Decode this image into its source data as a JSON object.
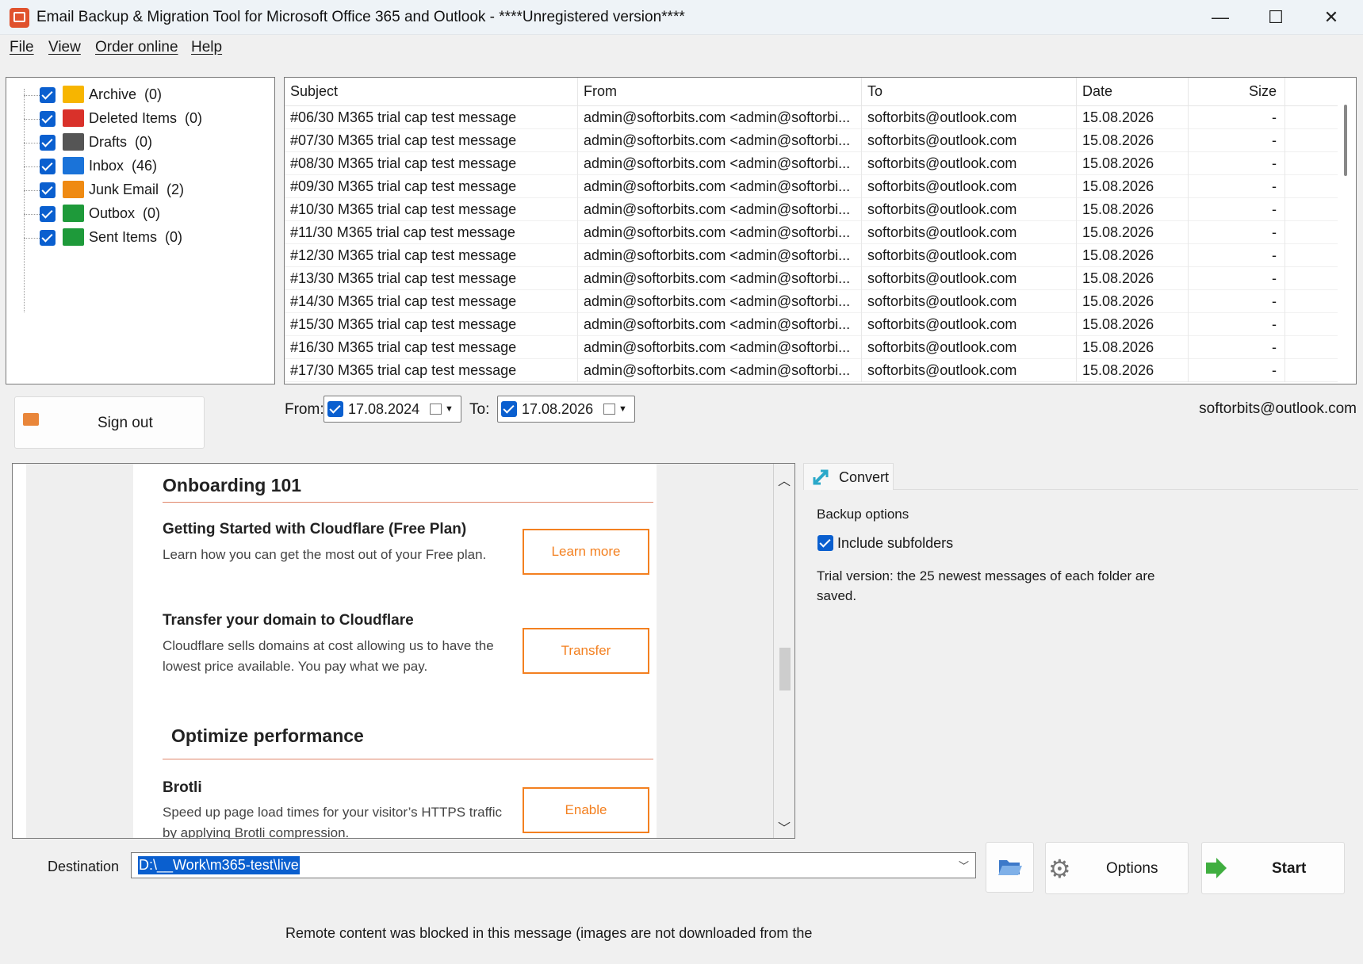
{
  "window": {
    "title": "Email Backup & Migration Tool for Microsoft Office 365 and Outlook - ****Unregistered version****",
    "controls": [
      "—",
      "☐",
      "✕"
    ]
  },
  "menu": [
    "File",
    "View",
    "Order online",
    "Help"
  ],
  "folders": [
    {
      "name": "Archive",
      "count": "(0)",
      "color": "#f7b500",
      "icon": "folder-icon"
    },
    {
      "name": "Deleted Items",
      "count": "(0)",
      "color": "#d9312a",
      "icon": "deleted-folder-icon"
    },
    {
      "name": "Drafts",
      "count": "(0)",
      "color": "#555555",
      "icon": "drafts-folder-icon"
    },
    {
      "name": "Inbox",
      "count": "(46)",
      "color": "#1a73d9",
      "icon": "inbox-folder-icon"
    },
    {
      "name": "Junk Email",
      "count": "(2)",
      "color": "#ef8a12",
      "icon": "junk-folder-icon"
    },
    {
      "name": "Outbox",
      "count": "(0)",
      "color": "#1e9a3a",
      "icon": "outbox-folder-icon"
    },
    {
      "name": "Sent Items",
      "count": "(0)",
      "color": "#1e9a3a",
      "icon": "sent-folder-icon"
    }
  ],
  "grid": {
    "columns": [
      "Subject",
      "From",
      "To",
      "Date",
      "Size"
    ],
    "rows": [
      [
        "#06/30 M365 trial cap test message",
        "admin@softorbits.com <admin@softorbi...",
        "softorbits@outlook.com",
        "15.08.2026",
        "-"
      ],
      [
        "#07/30 M365 trial cap test message",
        "admin@softorbits.com <admin@softorbi...",
        "softorbits@outlook.com",
        "15.08.2026",
        "-"
      ],
      [
        "#08/30 M365 trial cap test message",
        "admin@softorbits.com <admin@softorbi...",
        "softorbits@outlook.com",
        "15.08.2026",
        "-"
      ],
      [
        "#09/30 M365 trial cap test message",
        "admin@softorbits.com <admin@softorbi...",
        "softorbits@outlook.com",
        "15.08.2026",
        "-"
      ],
      [
        "#10/30 M365 trial cap test message",
        "admin@softorbits.com <admin@softorbi...",
        "softorbits@outlook.com",
        "15.08.2026",
        "-"
      ],
      [
        "#11/30 M365 trial cap test message",
        "admin@softorbits.com <admin@softorbi...",
        "softorbits@outlook.com",
        "15.08.2026",
        "-"
      ],
      [
        "#12/30 M365 trial cap test message",
        "admin@softorbits.com <admin@softorbi...",
        "softorbits@outlook.com",
        "15.08.2026",
        "-"
      ],
      [
        "#13/30 M365 trial cap test message",
        "admin@softorbits.com <admin@softorbi...",
        "softorbits@outlook.com",
        "15.08.2026",
        "-"
      ],
      [
        "#14/30 M365 trial cap test message",
        "admin@softorbits.com <admin@softorbi...",
        "softorbits@outlook.com",
        "15.08.2026",
        "-"
      ],
      [
        "#15/30 M365 trial cap test message",
        "admin@softorbits.com <admin@softorbi...",
        "softorbits@outlook.com",
        "15.08.2026",
        "-"
      ],
      [
        "#16/30 M365 trial cap test message",
        "admin@softorbits.com <admin@softorbi...",
        "softorbits@outlook.com",
        "15.08.2026",
        "-"
      ],
      [
        "#17/30 M365 trial cap test message",
        "admin@softorbits.com <admin@softorbi...",
        "softorbits@outlook.com",
        "15.08.2026",
        "-"
      ]
    ]
  },
  "signout_label": "Sign out",
  "date_range": {
    "from_label": "From:",
    "from_value": "17.08.2024",
    "to_label": "To:",
    "to_value": "17.08.2026"
  },
  "account": "softorbits@outlook.com",
  "preview": {
    "heading1": "Onboarding 101",
    "item1_title": "Getting Started with Cloudflare (Free Plan)",
    "item1_desc": "Learn how you can get the most out of your Free plan.",
    "item1_button": "Learn more",
    "item2_title": "Transfer your domain to Cloudflare",
    "item2_desc1": "Cloudflare sells domains at cost allowing us to have the",
    "item2_desc2": "lowest price available. You pay what we pay.",
    "item2_button": "Transfer",
    "heading2": "Optimize performance",
    "item3_title": "Brotli",
    "item3_desc1": "Speed up page load times for your visitor’s HTTPS traffic",
    "item3_desc2": "by applying Brotli compression.",
    "item3_button": "Enable",
    "accent": "#f38020"
  },
  "convert_tab": "Convert",
  "backup_options": {
    "title": "Backup options",
    "include_subfolders": "Include subfolders",
    "trial_note1": "Trial version: the 25 newest messages of each folder are",
    "trial_note2": "saved."
  },
  "destination": {
    "label": "Destination",
    "value": "D:\\__Work\\m365-test\\live"
  },
  "options_label": "Options",
  "start_label": "Start",
  "status": "Remote content was blocked in this message (images are not downloaded from the"
}
